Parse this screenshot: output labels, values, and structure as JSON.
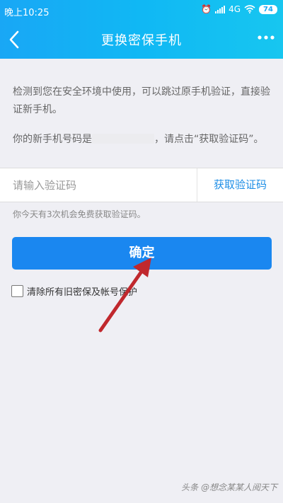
{
  "status": {
    "time": "晚上10:25",
    "network": "4G",
    "battery": "74"
  },
  "nav": {
    "title": "更换密保手机"
  },
  "content": {
    "notice": "检测到您在安全环境中使用，可以跳过原手机验证，直接验证新手机。",
    "phone_prefix": "你的新手机号码是",
    "phone_suffix": "，请点击“获取验证码”。",
    "code_placeholder": "请输入验证码",
    "get_code_label": "获取验证码",
    "tip": "你今天有3次机会免费获取验证码。",
    "confirm_label": "确定",
    "clear_label": "清除所有旧密保及帐号保护"
  },
  "watermark": "头条 @想念某某人阅天下",
  "colors": {
    "accent": "#1a87f0",
    "header": "#19a7f5",
    "link": "#1d8ee6",
    "annotation_arrow": "#c0282d"
  }
}
